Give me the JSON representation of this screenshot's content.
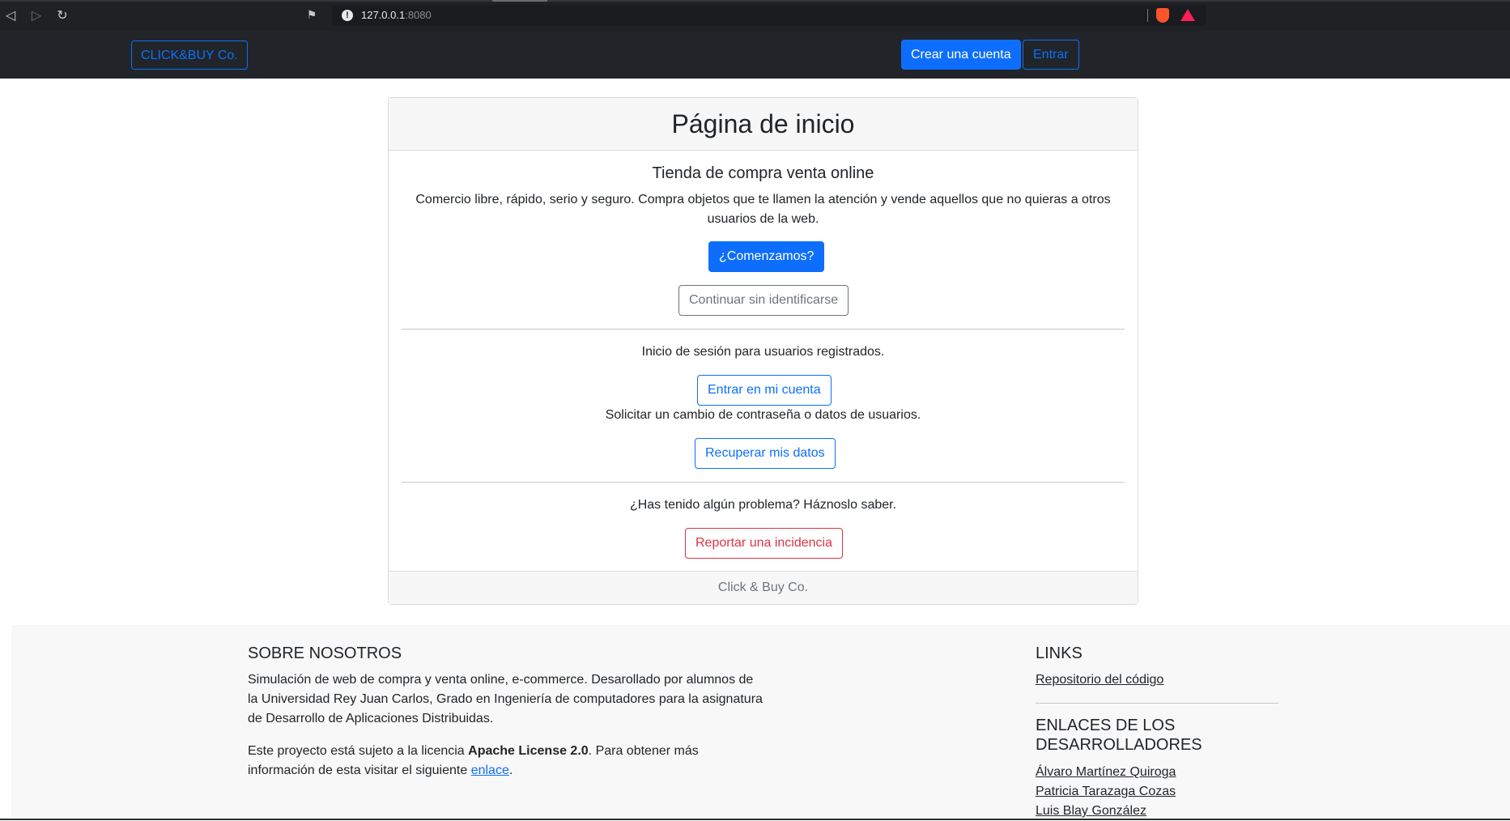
{
  "browser": {
    "url_host": "127.0.0.1",
    "url_port": ":8080",
    "back_icon": "back-icon",
    "forward_icon": "forward-icon",
    "reload_icon": "reload-icon",
    "bookmark_icon": "bookmark-icon"
  },
  "navbar": {
    "brand": "CLICK&BUY Co.",
    "create_account": "Crear una cuenta",
    "login": "Entrar"
  },
  "card": {
    "title": "Página de inicio",
    "subtitle": "Tienda de compra venta online",
    "description": "Comercio libre, rápido, serio y seguro. Compra objetos que te llamen la atención y vende aquellos que no quieras a otros usuarios de la web.",
    "start_button": "¿Comenzamos?",
    "guest_button": "Continuar sin identificarse",
    "login_text": "Inicio de sesión para usuarios registrados.",
    "login_button": "Entrar en mi cuenta",
    "recover_text": "Solicitar un cambio de contraseña o datos de usuarios.",
    "recover_button": "Recuperar mis datos",
    "problem_text": "¿Has tenido algún problema? Háznoslo saber.",
    "report_button": "Reportar una incidencia",
    "footer": "Click & Buy Co."
  },
  "footer": {
    "about_title": "SOBRE NOSOTROS",
    "about_text": "Simulación de web de compra y venta online, e-commerce. Desarollado por alumnos de la Universidad Rey Juan Carlos, Grado en Ingeniería de computadores para la asignatura de Desarrollo de Aplicaciones Distribuidas.",
    "license_pre": "Este proyecto está sujeto a la licencia ",
    "license_name": "Apache License 2.0",
    "license_post": ". Para obtener más información de esta visitar el siguiente ",
    "license_link": "enlace",
    "license_end": ".",
    "links_title": "LINKS",
    "repo_link": "Repositorio del código",
    "devs_title": "ENLACES DE LOS DESARROLLADORES",
    "devs": [
      "Álvaro Martínez Quiroga",
      "Patricia Tarazaga Cozas",
      "Luis Blay González"
    ]
  },
  "colors": {
    "primary": "#0d6efd",
    "danger": "#dc3545",
    "secondary": "#6c757d",
    "navbar_bg": "#212529"
  }
}
